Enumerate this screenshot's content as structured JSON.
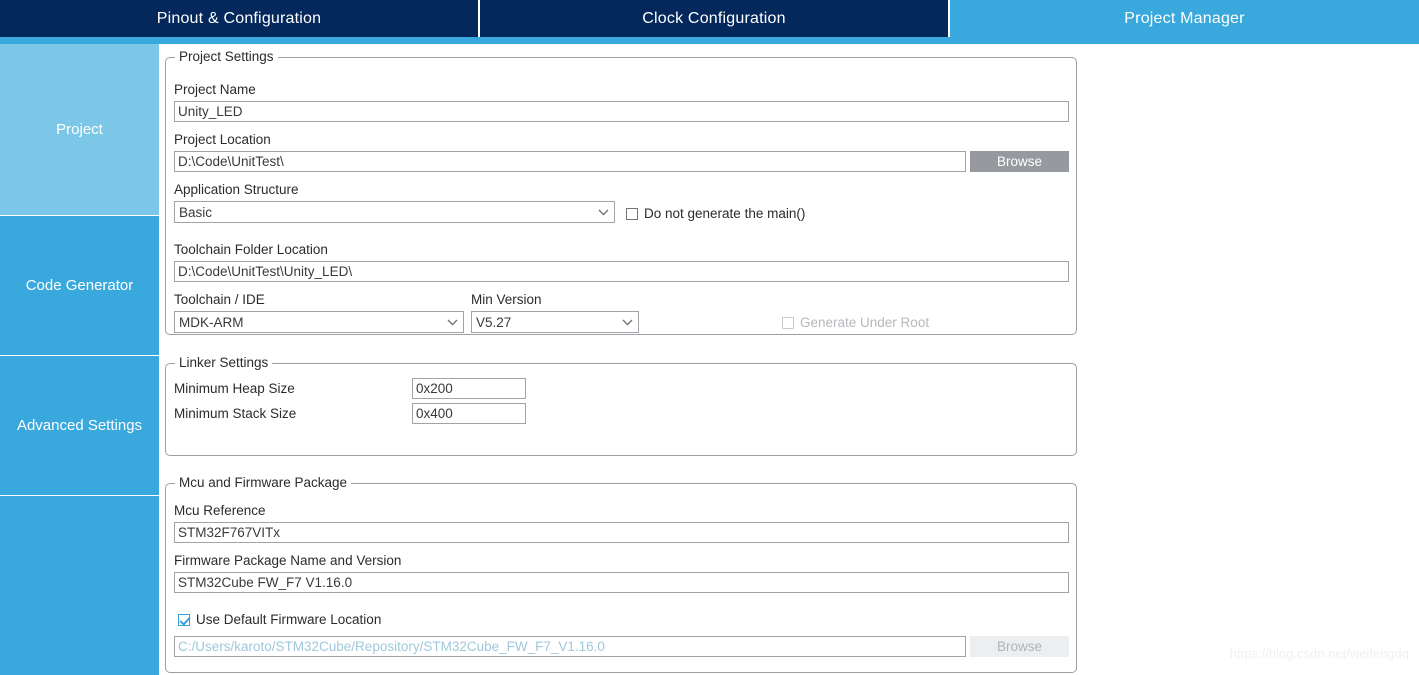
{
  "tabs": [
    {
      "label": "Pinout & Configuration",
      "active": false
    },
    {
      "label": "Clock Configuration",
      "active": false
    },
    {
      "label": "Project Manager",
      "active": true
    }
  ],
  "sidebar": {
    "items": [
      {
        "label": "Project",
        "selected": true
      },
      {
        "label": "Code Generator",
        "selected": false
      },
      {
        "label": "Advanced Settings",
        "selected": false
      },
      {
        "label": "",
        "selected": false
      }
    ]
  },
  "project_settings": {
    "group_title": "Project Settings",
    "project_name_label": "Project Name",
    "project_name_value": "Unity_LED",
    "project_location_label": "Project Location",
    "project_location_value": "D:\\Code\\UnitTest\\",
    "project_location_browse": "Browse",
    "application_structure_label": "Application Structure",
    "application_structure_value": "Basic",
    "do_not_generate_main_label": "Do not generate the main()",
    "do_not_generate_main_checked": false,
    "toolchain_folder_label": "Toolchain Folder Location",
    "toolchain_folder_value": "D:\\Code\\UnitTest\\Unity_LED\\",
    "toolchain_ide_label": "Toolchain / IDE",
    "toolchain_ide_value": "MDK-ARM",
    "min_version_label": "Min Version",
    "min_version_value": "V5.27",
    "generate_under_root_label": "Generate Under Root",
    "generate_under_root_checked": false
  },
  "linker_settings": {
    "group_title": "Linker Settings",
    "min_heap_label": "Minimum Heap Size",
    "min_heap_value": "0x200",
    "min_stack_label": "Minimum Stack Size",
    "min_stack_value": "0x400"
  },
  "mcu_firmware": {
    "group_title": "Mcu and Firmware Package",
    "mcu_reference_label": "Mcu Reference",
    "mcu_reference_value": "STM32F767VITx",
    "firmware_package_label": "Firmware Package Name and Version",
    "firmware_package_value": "STM32Cube FW_F7 V1.16.0",
    "use_default_firmware_label": "Use Default Firmware Location",
    "use_default_firmware_checked": true,
    "firmware_location_value": "C:/Users/karoto/STM32Cube/Repository/STM32Cube_FW_F7_V1.16.0",
    "firmware_browse": "Browse"
  },
  "watermark": "https://blog.csdn.net/weifengdq",
  "colors": {
    "tab_inactive": "#04275c",
    "tab_active": "#39a8dc",
    "sidebar": "#39a8dc",
    "sidebar_selected": "#7cc6e8",
    "browse_enabled": "#96999d",
    "checkbox_accent": "#3aa3d8"
  }
}
